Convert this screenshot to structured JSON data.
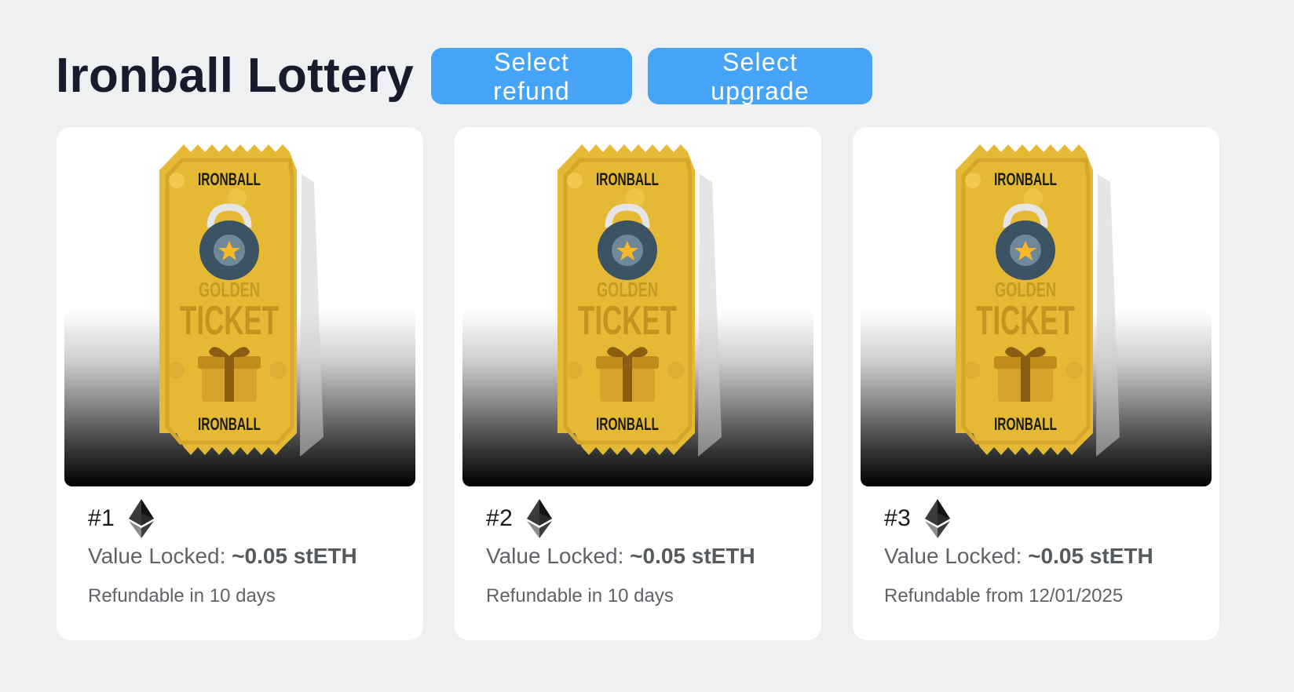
{
  "header": {
    "title": "Ironball Lottery",
    "refund_button_label": "Select refund",
    "upgrade_button_label": "Select upgrade"
  },
  "colors": {
    "button_bg": "#45a4f7",
    "title_color": "#171b2e",
    "ticket_gold": "#e8bb3a",
    "page_bg": "#eef0f2"
  },
  "tickets": [
    {
      "number": "#1",
      "value_label": "Value Locked: ",
      "value_amount": "~0.05 stETH",
      "refund_text": "Refundable in 10 days",
      "image": {
        "top_brand": "IRONBALL",
        "line1": "GOLDEN",
        "line2": "TICKET",
        "bottom_brand": "IRONBALL"
      },
      "currency_icon": "ethereum-icon"
    },
    {
      "number": "#2",
      "value_label": "Value Locked: ",
      "value_amount": "~0.05 stETH",
      "refund_text": "Refundable in 10 days",
      "image": {
        "top_brand": "IRONBALL",
        "line1": "GOLDEN",
        "line2": "TICKET",
        "bottom_brand": "IRONBALL"
      },
      "currency_icon": "ethereum-icon"
    },
    {
      "number": "#3",
      "value_label": "Value Locked: ",
      "value_amount": "~0.05 stETH",
      "refund_text": "Refundable from 12/01/2025",
      "image": {
        "top_brand": "IRONBALL",
        "line1": "GOLDEN",
        "line2": "TICKET",
        "bottom_brand": "IRONBALL"
      },
      "currency_icon": "ethereum-icon"
    }
  ]
}
